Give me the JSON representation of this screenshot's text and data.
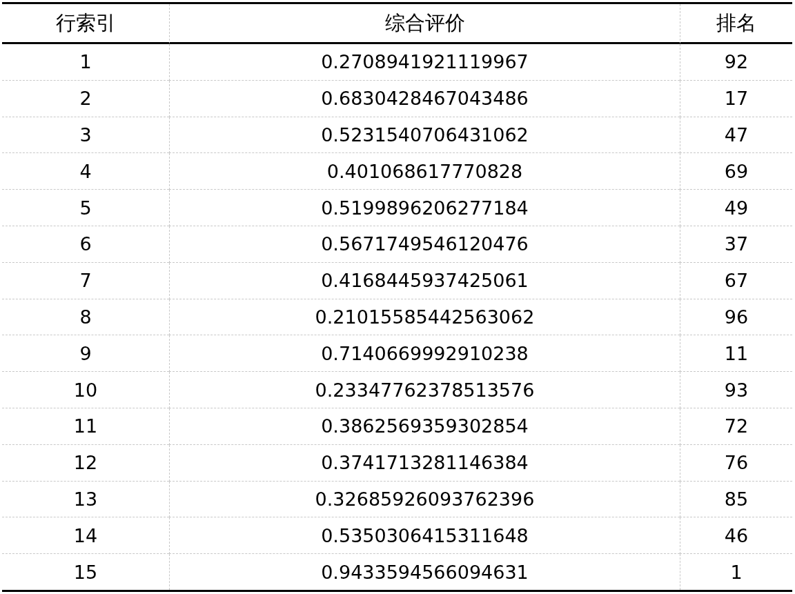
{
  "table": {
    "columns": [
      "行索引",
      "综合评价",
      "排名"
    ],
    "rows": [
      [
        "1",
        "0.2708941921119967",
        "92"
      ],
      [
        "2",
        "0.6830428467043486",
        "17"
      ],
      [
        "3",
        "0.5231540706431062",
        "47"
      ],
      [
        "4",
        "0.401068617770828",
        "69"
      ],
      [
        "5",
        "0.5199896206277184",
        "49"
      ],
      [
        "6",
        "0.5671749546120476",
        "37"
      ],
      [
        "7",
        "0.4168445937425061",
        "67"
      ],
      [
        "8",
        "0.21015585442563062",
        "96"
      ],
      [
        "9",
        "0.7140669992910238",
        "11"
      ],
      [
        "10",
        "0.23347762378513576",
        "93"
      ],
      [
        "11",
        "0.3862569359302854",
        "72"
      ],
      [
        "12",
        "0.3741713281146384",
        "76"
      ],
      [
        "13",
        "0.32685926093762396",
        "85"
      ],
      [
        "14",
        "0.5350306415311648",
        "46"
      ],
      [
        "15",
        "0.9433594566094631",
        "1"
      ]
    ]
  }
}
